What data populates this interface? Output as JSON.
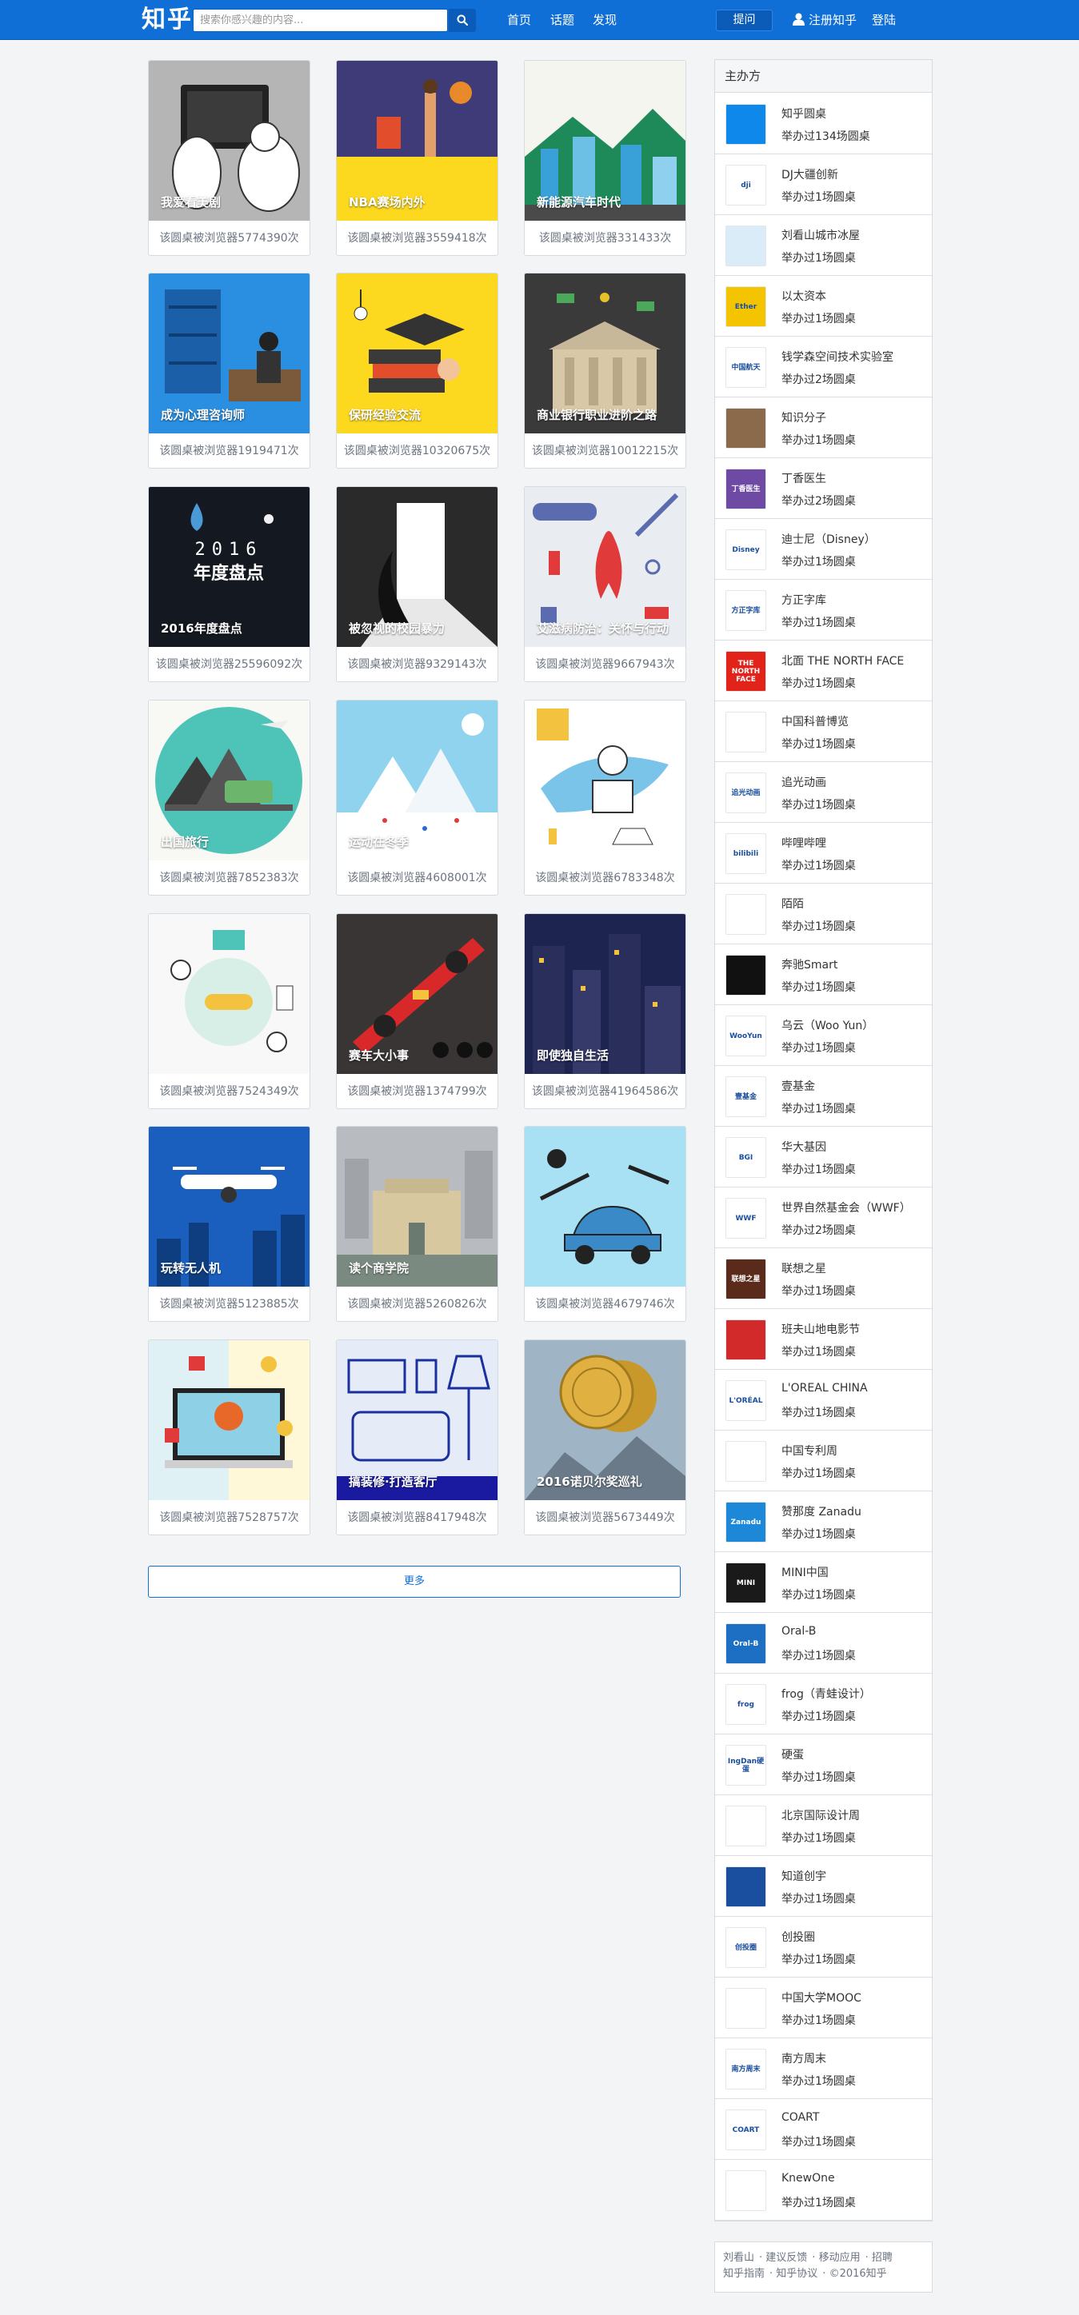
{
  "header": {
    "logo": "知乎",
    "search_placeholder": "搜索你感兴趣的内容...",
    "nav": [
      "首页",
      "话题",
      "发现"
    ],
    "ask": "提问",
    "register": "注册知乎",
    "login": "登陆"
  },
  "cards": [
    {
      "title": "我爱看美剧",
      "count": "该圆桌被浏览器5774390次"
    },
    {
      "title": "NBA赛场内外",
      "count": "该圆桌被浏览器3559418次"
    },
    {
      "title": "新能源汽车时代",
      "count": "该圆桌被浏览器331433次"
    },
    {
      "title": "成为心理咨询师",
      "count": "该圆桌被浏览器1919471次"
    },
    {
      "title": "保研经验交流",
      "count": "该圆桌被浏览器10320675次"
    },
    {
      "title": "商业银行职业进阶之路",
      "count": "该圆桌被浏览器10012215次"
    },
    {
      "title": "2016年度盘点",
      "count": "该圆桌被浏览器25596092次"
    },
    {
      "title": "被忽视的校园暴力",
      "count": "该圆桌被浏览器9329143次"
    },
    {
      "title": "艾滋病防治：关怀与行动",
      "count": "该圆桌被浏览器9667943次"
    },
    {
      "title": "出国旅行",
      "count": "该圆桌被浏览器7852383次"
    },
    {
      "title": "运动在冬季",
      "count": "该圆桌被浏览器4608001次"
    },
    {
      "title": "",
      "count": "该圆桌被浏览器6783348次"
    },
    {
      "title": "",
      "count": "该圆桌被浏览器7524349次"
    },
    {
      "title": "赛车大小事",
      "count": "该圆桌被浏览器1374799次"
    },
    {
      "title": "即使独自生活",
      "count": "该圆桌被浏览器41964586次"
    },
    {
      "title": "玩转无人机",
      "count": "该圆桌被浏览器5123885次"
    },
    {
      "title": "读个商学院",
      "count": "该圆桌被浏览器5260826次"
    },
    {
      "title": "",
      "count": "该圆桌被浏览器4679746次"
    },
    {
      "title": "",
      "count": "该圆桌被浏览器7528757次"
    },
    {
      "title": "搞装修·打造客厅",
      "count": "该圆桌被浏览器8417948次"
    },
    {
      "title": "2016诺贝尔奖巡礼",
      "count": "该圆桌被浏览器5673449次"
    }
  ],
  "more": "更多",
  "sidebar": {
    "title": "主办方",
    "hosts": [
      {
        "name": "知乎圆桌",
        "count": "举办过134场圆桌",
        "logo_text": "",
        "color": "#0f88eb"
      },
      {
        "name": "DJ大疆创新",
        "count": "举办过1场圆桌",
        "logo_text": "dji",
        "color": "#ffffff"
      },
      {
        "name": "刘看山城市冰屋",
        "count": "举办过1场圆桌",
        "logo_text": "",
        "color": "#d9ecf7"
      },
      {
        "name": "以太资本",
        "count": "举办过1场圆桌",
        "logo_text": "Ether",
        "color": "#f4c400"
      },
      {
        "name": "钱学森空间技术实验室",
        "count": "举办过2场圆桌",
        "logo_text": "中国航天",
        "color": "#ffffff"
      },
      {
        "name": "知识分子",
        "count": "举办过1场圆桌",
        "logo_text": "",
        "color": "#8a6a4a"
      },
      {
        "name": "丁香医生",
        "count": "举办过2场圆桌",
        "logo_text": "丁香医生",
        "color": "#6f4aa5"
      },
      {
        "name": "迪士尼（Disney）",
        "count": "举办过1场圆桌",
        "logo_text": "Disney",
        "color": "#ffffff"
      },
      {
        "name": "方正字库",
        "count": "举办过1场圆桌",
        "logo_text": "方正字库",
        "color": "#ffffff"
      },
      {
        "name": "北面 THE NORTH FACE",
        "count": "举办过1场圆桌",
        "logo_text": "THE NORTH FACE",
        "color": "#e2231a"
      },
      {
        "name": "中国科普博览",
        "count": "举办过1场圆桌",
        "logo_text": "",
        "color": "#ffffff"
      },
      {
        "name": "追光动画",
        "count": "举办过1场圆桌",
        "logo_text": "追光动画",
        "color": "#ffffff"
      },
      {
        "name": "哔哩哔哩",
        "count": "举办过1场圆桌",
        "logo_text": "bilibili",
        "color": "#ffffff"
      },
      {
        "name": "陌陌",
        "count": "举办过1场圆桌",
        "logo_text": "",
        "color": "#ffffff"
      },
      {
        "name": "奔驰Smart",
        "count": "举办过1场圆桌",
        "logo_text": "",
        "color": "#111111"
      },
      {
        "name": "乌云（Woo Yun）",
        "count": "举办过1场圆桌",
        "logo_text": "WooYun",
        "color": "#ffffff"
      },
      {
        "name": "壹基金",
        "count": "举办过1场圆桌",
        "logo_text": "壹基金",
        "color": "#ffffff"
      },
      {
        "name": "华大基因",
        "count": "举办过1场圆桌",
        "logo_text": "BGI",
        "color": "#ffffff"
      },
      {
        "name": "世界自然基金会（WWF）",
        "count": "举办过2场圆桌",
        "logo_text": "WWF",
        "color": "#ffffff"
      },
      {
        "name": "联想之星",
        "count": "举办过1场圆桌",
        "logo_text": "联想之星",
        "color": "#5a2a1a"
      },
      {
        "name": "班夫山地电影节",
        "count": "举办过1场圆桌",
        "logo_text": "",
        "color": "#d22a2a"
      },
      {
        "name": "L'OREAL CHINA",
        "count": "举办过1场圆桌",
        "logo_text": "L'ORÉAL",
        "color": "#ffffff"
      },
      {
        "name": "中国专利周",
        "count": "举办过1场圆桌",
        "logo_text": "",
        "color": "#ffffff"
      },
      {
        "name": "赞那度 Zanadu",
        "count": "举办过1场圆桌",
        "logo_text": "Zanadu",
        "color": "#1e88d8"
      },
      {
        "name": "MINI中国",
        "count": "举办过1场圆桌",
        "logo_text": "MINI",
        "color": "#1a1a1a"
      },
      {
        "name": "Oral-B",
        "count": "举办过1场圆桌",
        "logo_text": "Oral-B",
        "color": "#1d6fc4"
      },
      {
        "name": "frog（青蛙设计）",
        "count": "举办过1场圆桌",
        "logo_text": "frog",
        "color": "#ffffff"
      },
      {
        "name": "硬蛋",
        "count": "举办过1场圆桌",
        "logo_text": "IngDan硬蛋",
        "color": "#ffffff"
      },
      {
        "name": "北京国际设计周",
        "count": "举办过1场圆桌",
        "logo_text": "",
        "color": "#ffffff"
      },
      {
        "name": "知道创宇",
        "count": "举办过1场圆桌",
        "logo_text": "",
        "color": "#1a4fa0"
      },
      {
        "name": "创投圈",
        "count": "举办过1场圆桌",
        "logo_text": "创投圈",
        "color": "#ffffff"
      },
      {
        "name": "中国大学MOOC",
        "count": "举办过1场圆桌",
        "logo_text": "",
        "color": "#ffffff"
      },
      {
        "name": "南方周末",
        "count": "举办过1场圆桌",
        "logo_text": "南方周末",
        "color": "#ffffff"
      },
      {
        "name": "COART",
        "count": "举办过1场圆桌",
        "logo_text": "COART",
        "color": "#ffffff"
      },
      {
        "name": "KnewOne",
        "count": "举办过1场圆桌",
        "logo_text": "",
        "color": "#ffffff"
      }
    ]
  },
  "footer": {
    "links": [
      "刘看山",
      "建议反馈",
      "移动应用",
      "招聘",
      "知乎指南",
      "知乎协议"
    ],
    "copyright": "©2016知乎"
  }
}
